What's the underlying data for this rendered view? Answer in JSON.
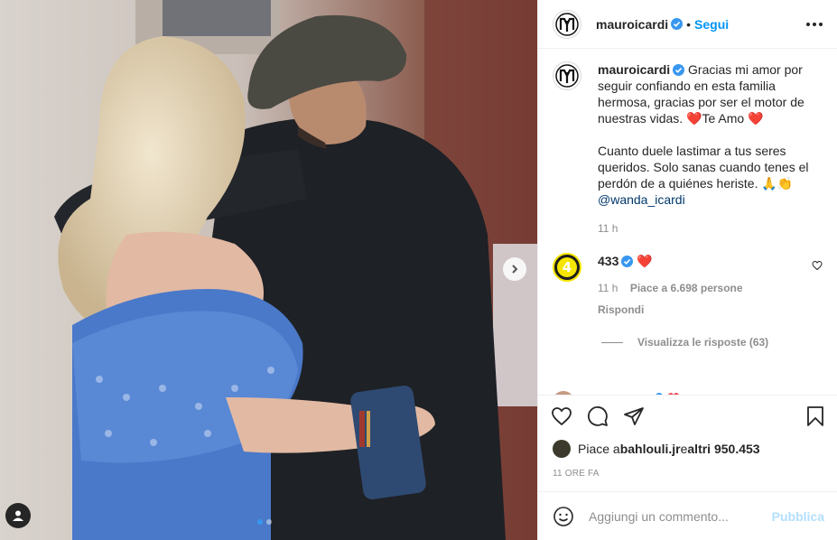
{
  "post": {
    "author": "mauroicardi",
    "follow_label": "Segui",
    "separator": "•",
    "caption": "Gracias mi amor por seguir confiando en esta familia hermosa, gracias por ser el motor de nuestras vidas. ❤️Te Amo ❤️\n\nCuanto duele lastimar a tus seres queridos. Solo sanas cuando tenes el perdón de a quiénes heriste. 🙏👏",
    "mention": "@wanda_icardi",
    "caption_time": "11 h"
  },
  "comments": [
    {
      "username": "433",
      "text": "❤️",
      "time": "11 h",
      "likes_label": "Piace a 6.698 persone",
      "reply_label": "Rispondi",
      "view_replies_label": "Visualizza le risposte (63)"
    }
  ],
  "footer": {
    "likes_prefix": "Piace a ",
    "likes_user": "bahlouli.jr",
    "likes_middle": " e ",
    "likes_others": "altri 950.453",
    "timestamp": "11 ORE FA",
    "comment_placeholder": "Aggiungi un commento...",
    "publish_label": "Pubblica"
  },
  "carousel": {
    "total": 2,
    "current": 1
  },
  "colors": {
    "accent": "#0095f6",
    "verified": "#3897f0",
    "heart": "#ed4956",
    "muted": "#8e8e8e"
  },
  "icons": [
    "more-icon",
    "heart-icon",
    "comment-icon",
    "share-icon",
    "save-icon",
    "emoji-icon",
    "next-arrow-icon",
    "user-tag-icon",
    "verified-icon"
  ]
}
